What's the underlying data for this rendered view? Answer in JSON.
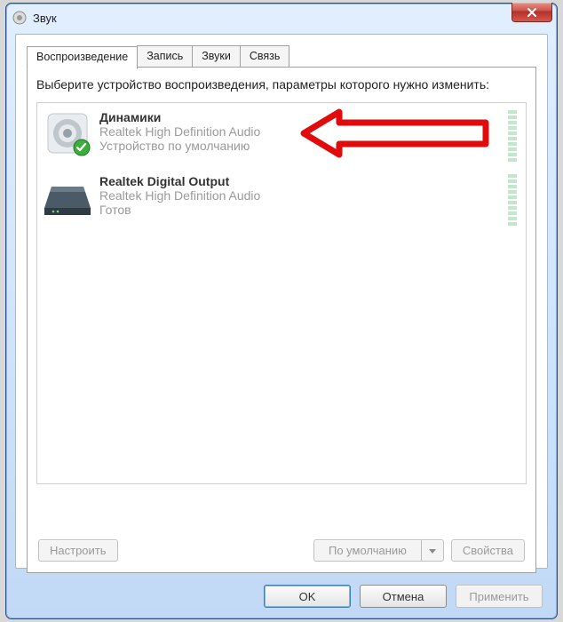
{
  "window": {
    "title": "Звук"
  },
  "tabs": [
    {
      "label": "Воспроизведение",
      "active": true
    },
    {
      "label": "Запись",
      "active": false
    },
    {
      "label": "Звуки",
      "active": false
    },
    {
      "label": "Связь",
      "active": false
    }
  ],
  "instruction": "Выберите устройство воспроизведения, параметры которого нужно изменить:",
  "devices": [
    {
      "name": "Динамики",
      "driver": "Realtek High Definition Audio",
      "status": "Устройство по умолчанию",
      "default": true,
      "annotated": true
    },
    {
      "name": "Realtek Digital Output",
      "driver": "Realtek High Definition Audio",
      "status": "Готов",
      "default": false,
      "annotated": false
    }
  ],
  "buttons": {
    "configure": "Настроить",
    "set_default": "По умолчанию",
    "properties": "Свойства",
    "ok": "OK",
    "cancel": "Отмена",
    "apply": "Применить"
  }
}
